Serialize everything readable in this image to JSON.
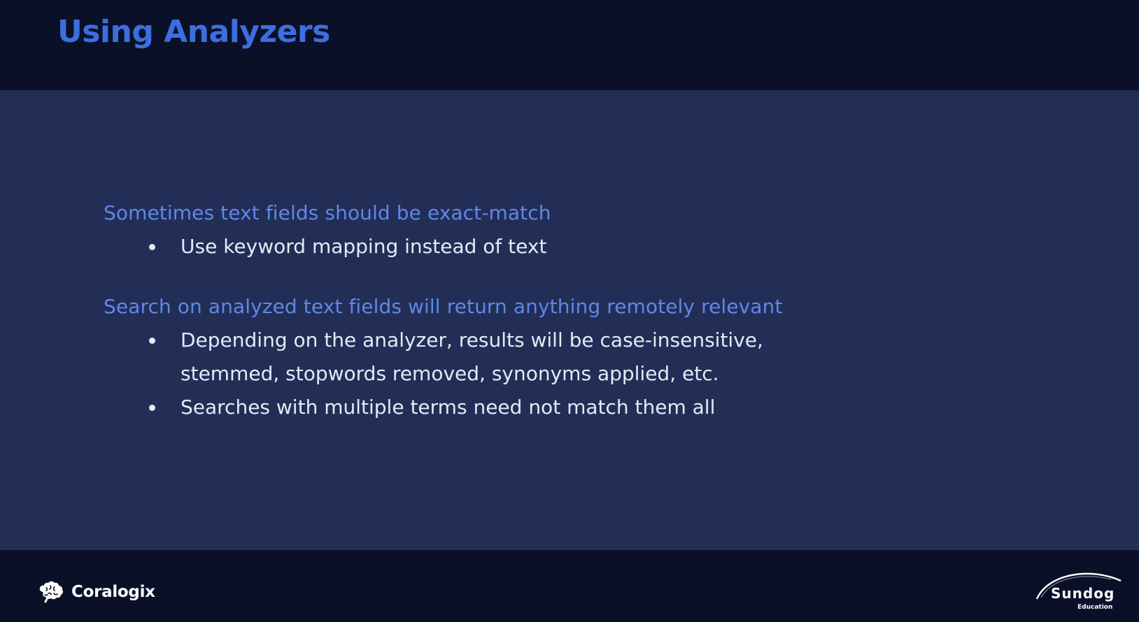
{
  "slide": {
    "title": "Using Analyzers",
    "sections": [
      {
        "heading": "Sometimes text fields should be exact-match",
        "bullets": [
          "Use keyword mapping instead of text"
        ]
      },
      {
        "heading": "Search on analyzed text fields will return anything remotely relevant",
        "bullets": [
          "Depending on the analyzer, results will be case-insensitive, stemmed, stopwords removed, synonyms applied, etc.",
          "Searches with multiple terms need not match them all"
        ]
      }
    ]
  },
  "footer": {
    "left_logo": {
      "icon": "brain-icon",
      "text": "Coralogix"
    },
    "right_logo": {
      "text": "Sundog",
      "subtext": "Education"
    }
  },
  "colors": {
    "header_bg": "#0b1029",
    "body_bg": "#232e57",
    "title": "#3c6fde",
    "heading": "#5e88e8",
    "bullet_text": "#e6e9f3"
  }
}
